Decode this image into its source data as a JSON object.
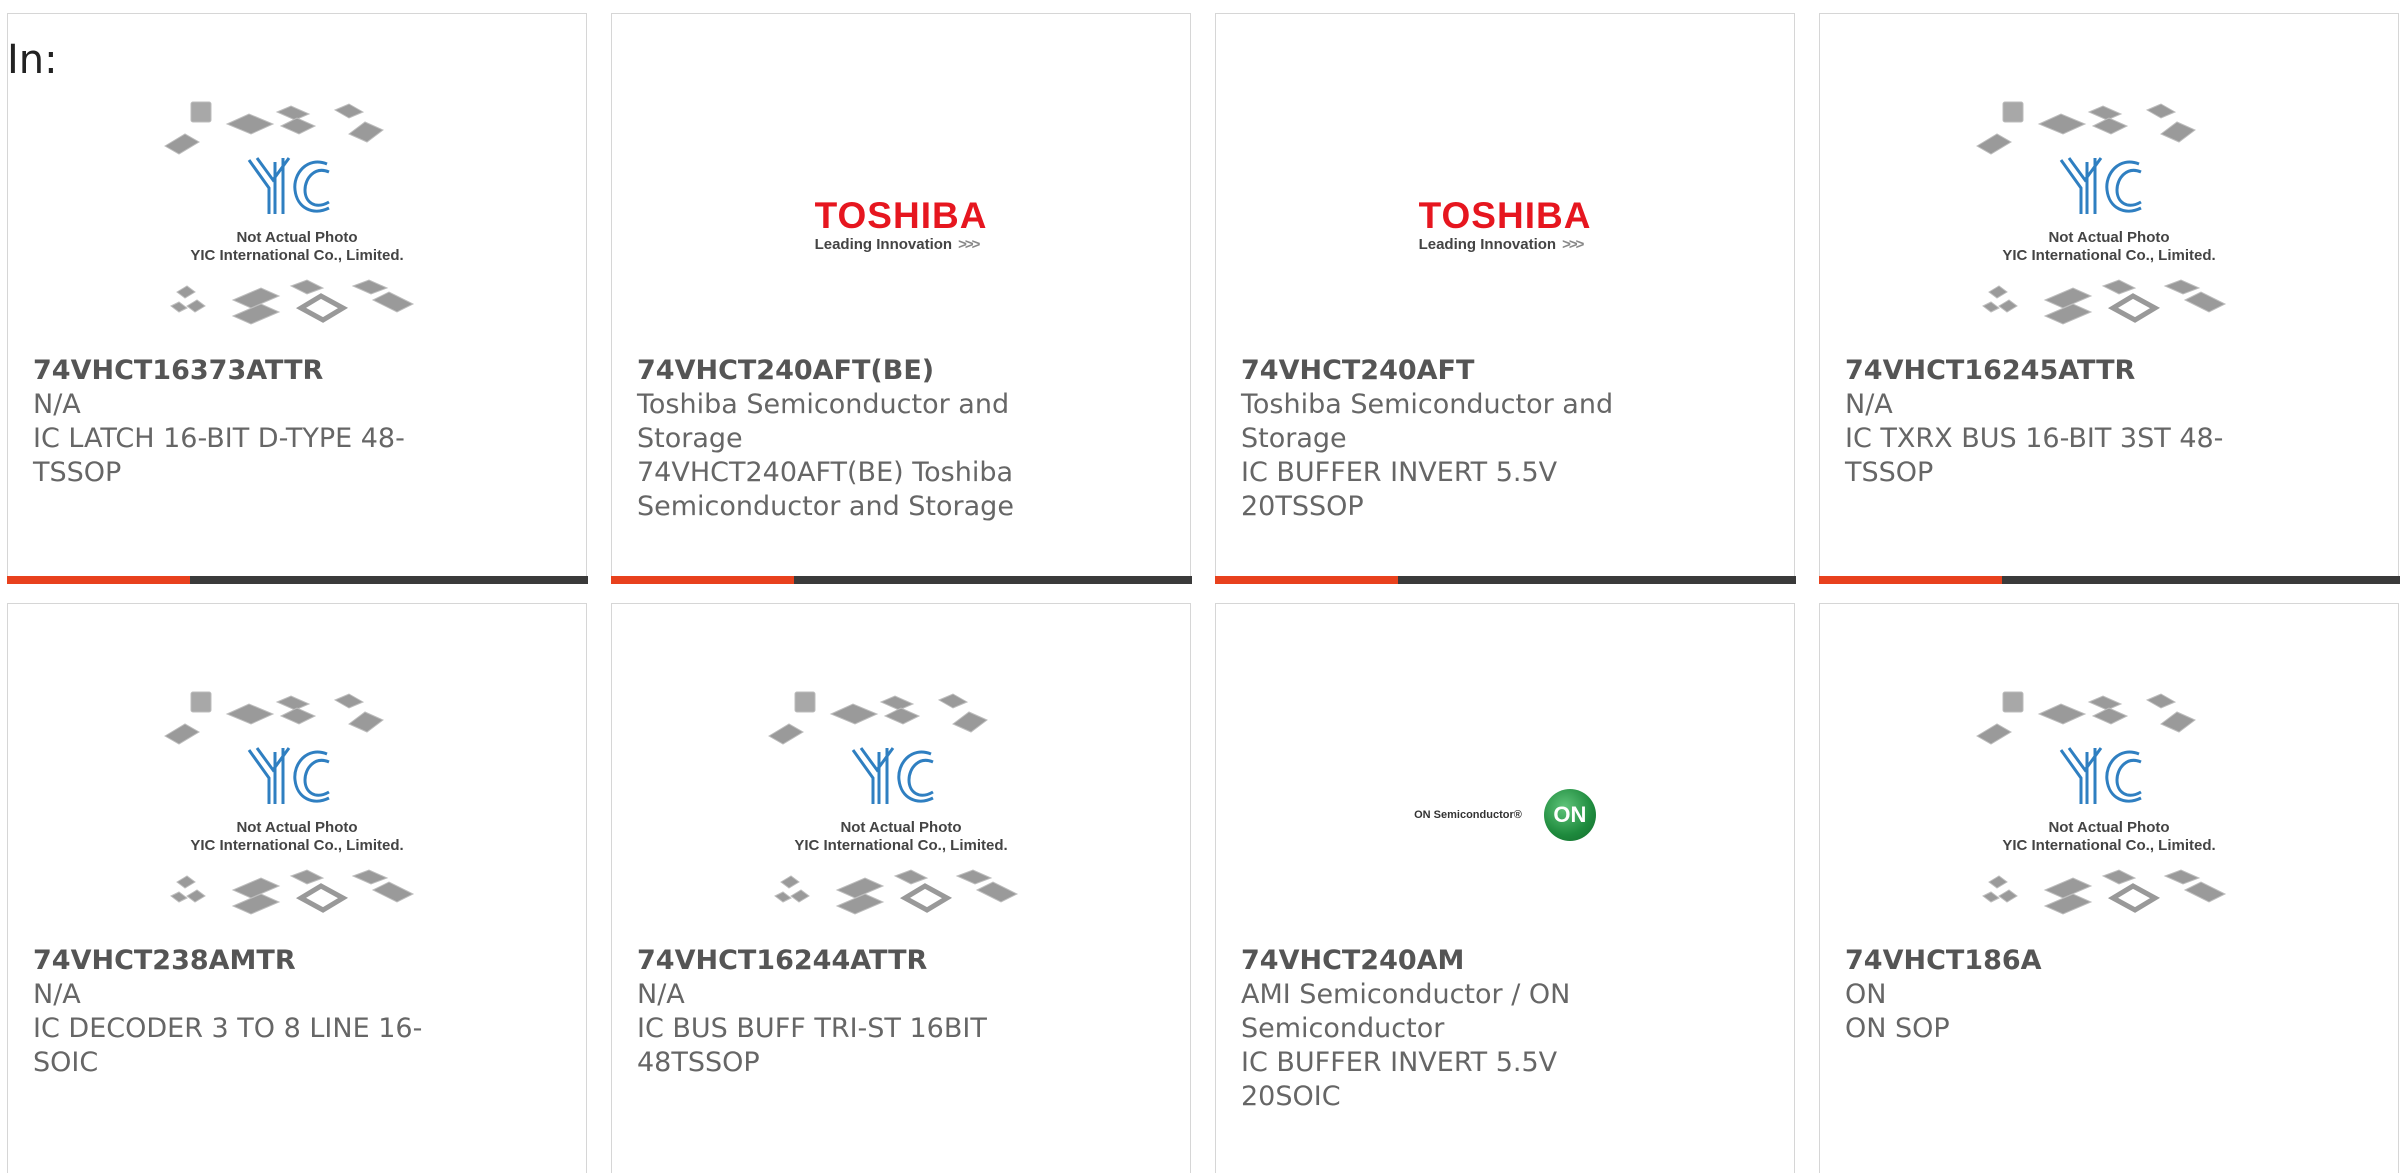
{
  "filter": {
    "label": "In:"
  },
  "brand": {
    "accent": "#e8411d",
    "bar": "#3a3a3a"
  },
  "products": [
    {
      "part": "74VHCT16373ATTR",
      "manufacturer": "N/A",
      "description": "IC LATCH 16-BIT D-TYPE 48-TSSOP",
      "image": "yic-placeholder"
    },
    {
      "part": "74VHCT240AFT(BE)",
      "manufacturer": "Toshiba Semiconductor and Storage",
      "description": "74VHCT240AFT(BE) Toshiba Semiconductor and Storage",
      "image": "toshiba-logo"
    },
    {
      "part": "74VHCT240AFT",
      "manufacturer": "Toshiba Semiconductor and Storage",
      "description": "IC BUFFER INVERT 5.5V 20TSSOP",
      "image": "toshiba-logo"
    },
    {
      "part": "74VHCT16245ATTR",
      "manufacturer": "N/A",
      "description": "IC TXRX BUS 16-BIT 3ST 48-TSSOP",
      "image": "yic-placeholder"
    },
    {
      "part": "74VHCT238AMTR",
      "manufacturer": "N/A",
      "description": "IC DECODER 3 TO 8 LINE 16-SOIC",
      "image": "yic-placeholder"
    },
    {
      "part": "74VHCT16244ATTR",
      "manufacturer": "N/A",
      "description": "IC BUS BUFF TRI-ST 16BIT 48TSSOP",
      "image": "yic-placeholder"
    },
    {
      "part": "74VHCT240AM",
      "manufacturer": "AMI Semiconductor / ON Semiconductor",
      "description": "IC BUFFER INVERT 5.5V 20SOIC",
      "image": "onsemi-logo"
    },
    {
      "part": "74VHCT186A",
      "manufacturer": "ON",
      "description": "ON SOP",
      "image": "yic-placeholder"
    }
  ],
  "yic": {
    "line1": "Not Actual Photo",
    "line2": "YIC International Co., Limited."
  },
  "toshiba": {
    "word": "TOSHIBA",
    "tagline": "Leading Innovation",
    "arrows": ">>>"
  },
  "onsemi": {
    "word": "ON Semiconductor®",
    "ball": "ON"
  }
}
